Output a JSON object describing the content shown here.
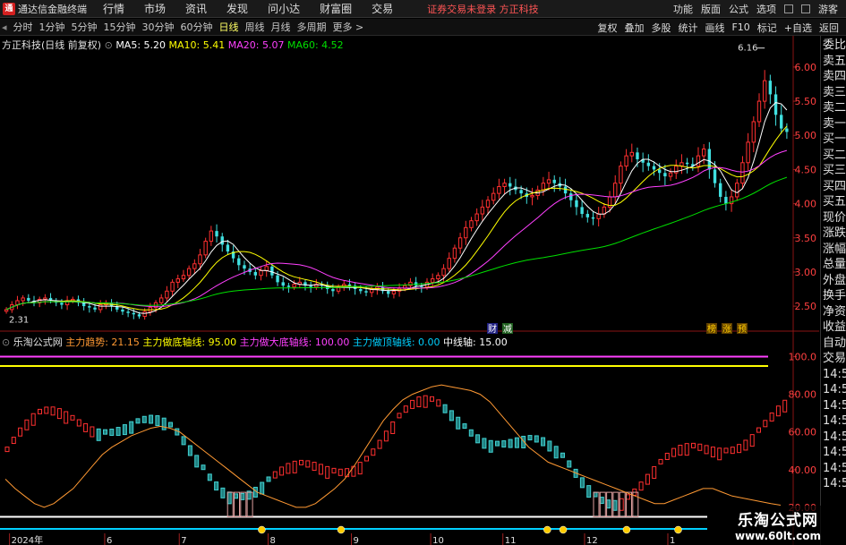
{
  "app": {
    "title": "通达信金融终端",
    "menu": [
      "行情",
      "市场",
      "资讯",
      "发现",
      "问小达",
      "财富圈",
      "交易"
    ],
    "notice": "证券交易未登录  方正科技",
    "right_menu": [
      "功能",
      "版面",
      "公式",
      "选项"
    ],
    "guest": "游客"
  },
  "periods": [
    "分时",
    "1分钟",
    "5分钟",
    "15分钟",
    "30分钟",
    "60分钟",
    "日线",
    "周线",
    "月线",
    "多周期",
    "更多 >"
  ],
  "active_period": "日线",
  "tools": [
    "复权",
    "叠加",
    "多股",
    "统计",
    "画线",
    "F10",
    "标记",
    "+自选",
    "返回"
  ],
  "stock_line": {
    "name": "方正科技(日线 前复权)",
    "ma": [
      {
        "label": "MA5: 5.20",
        "color": "#ffffff"
      },
      {
        "label": "MA10: 5.41",
        "color": "#ffff00"
      },
      {
        "label": "MA20: 5.07",
        "color": "#ff40ff"
      },
      {
        "label": "MA60: 4.52",
        "color": "#00e000"
      }
    ]
  },
  "price_axis": [
    "6.00",
    "5.50",
    "5.00",
    "4.50",
    "4.00",
    "3.50",
    "3.00",
    "2.50"
  ],
  "markers": {
    "high": "6.16",
    "low": "2.31",
    "fin": "财",
    "jian": "减",
    "tags": [
      "榜",
      "涨",
      "预"
    ]
  },
  "indicator_line": {
    "name": "乐淘公式网",
    "items": [
      {
        "label": "主力趋势: 21.15",
        "color": "#ff9933"
      },
      {
        "label": "主力做底轴线: 95.00",
        "color": "#ffff00"
      },
      {
        "label": "主力做大底轴线: 100.00",
        "color": "#ff40ff"
      },
      {
        "label": "主力做顶轴线: 0.00",
        "color": "#00d0ff"
      },
      {
        "label": "中线轴: 15.00",
        "color": "#ffffff"
      }
    ]
  },
  "indicator_axis": [
    "100.0",
    "80.00",
    "60.00",
    "40.00",
    "20.00"
  ],
  "time_axis": [
    {
      "label": "2024年",
      "x": 0.012
    },
    {
      "label": "6",
      "x": 0.132
    },
    {
      "label": "7",
      "x": 0.226
    },
    {
      "label": "8",
      "x": 0.338
    },
    {
      "label": "9",
      "x": 0.443
    },
    {
      "label": "10",
      "x": 0.543
    },
    {
      "label": "11",
      "x": 0.634
    },
    {
      "label": "12",
      "x": 0.737
    },
    {
      "label": "1",
      "x": 0.842
    }
  ],
  "right_panel": [
    "委比",
    "卖五",
    "卖四",
    "卖三",
    "卖二",
    "卖一",
    "买一",
    "买二",
    "买三",
    "买四",
    "买五",
    "现价",
    "涨跌",
    "涨幅",
    "总量",
    "外盘",
    "换手",
    "净资",
    "收益",
    "自动",
    "交易",
    "14:56",
    "14:56",
    "14:56",
    "14:56",
    "14:56",
    "14:56",
    "14:56",
    "14:56"
  ],
  "watermark": {
    "line1": "乐淘公式网",
    "line2": "www.60lt.com"
  },
  "chart_data": {
    "type": "candlestick",
    "series": "daily",
    "first_close": 2.45,
    "last_close": 5.05,
    "high": 6.16,
    "low": 2.31,
    "ma": {
      "MA5": 5.2,
      "MA10": 5.41,
      "MA20": 5.07,
      "MA60": 4.52
    },
    "price_range": [
      2.2,
      6.3
    ],
    "indicator_range": [
      10,
      105
    ],
    "closes": [
      2.45,
      2.52,
      2.58,
      2.62,
      2.58,
      2.55,
      2.6,
      2.62,
      2.58,
      2.55,
      2.52,
      2.58,
      2.6,
      2.55,
      2.5,
      2.48,
      2.45,
      2.52,
      2.55,
      2.5,
      2.45,
      2.42,
      2.4,
      2.38,
      2.35,
      2.42,
      2.48,
      2.55,
      2.62,
      2.72,
      2.85,
      2.9,
      2.95,
      3.05,
      3.12,
      3.25,
      3.45,
      3.6,
      3.52,
      3.4,
      3.3,
      3.2,
      3.1,
      3.05,
      3.0,
      2.95,
      3.02,
      3.08,
      2.95,
      2.85,
      2.8,
      2.78,
      2.82,
      2.85,
      2.8,
      2.78,
      2.82,
      2.8,
      2.75,
      2.72,
      2.78,
      2.82,
      2.8,
      2.75,
      2.72,
      2.7,
      2.75,
      2.78,
      2.72,
      2.68,
      2.72,
      2.76,
      2.8,
      2.85,
      2.8,
      2.78,
      2.85,
      2.9,
      2.95,
      3.05,
      3.2,
      3.35,
      3.5,
      3.65,
      3.75,
      3.85,
      3.95,
      4.05,
      4.15,
      4.25,
      4.3,
      4.25,
      4.2,
      4.15,
      4.1,
      4.12,
      4.2,
      4.3,
      4.35,
      4.3,
      4.25,
      4.15,
      4.05,
      3.95,
      3.85,
      3.8,
      3.78,
      3.85,
      3.95,
      4.1,
      4.3,
      4.55,
      4.7,
      4.75,
      4.65,
      4.6,
      4.55,
      4.5,
      4.45,
      4.4,
      4.45,
      4.55,
      4.6,
      4.58,
      4.55,
      4.7,
      4.8,
      4.5,
      4.3,
      4.1,
      4.0,
      4.1,
      4.3,
      4.6,
      4.9,
      5.2,
      5.5,
      5.8,
      5.6,
      5.3,
      5.1,
      5.05
    ],
    "trend": [
      35,
      30,
      26,
      22,
      20,
      22,
      26,
      30,
      36,
      42,
      48,
      52,
      55,
      58,
      60,
      62,
      63,
      62,
      60,
      56,
      52,
      48,
      44,
      40,
      36,
      32,
      28,
      26,
      24,
      22,
      20,
      20,
      22,
      26,
      30,
      35,
      42,
      50,
      58,
      66,
      72,
      77,
      80,
      82,
      84,
      85,
      84,
      83,
      82,
      80,
      76,
      70,
      64,
      58,
      52,
      48,
      44,
      42,
      40,
      38,
      36,
      34,
      32,
      30,
      28,
      26,
      24,
      22,
      22,
      24,
      26,
      28,
      30,
      30,
      28,
      26,
      25,
      24,
      23,
      22,
      21.15
    ],
    "bottom_signals": [
      0.33,
      0.43,
      0.69,
      0.71,
      0.79,
      0.855
    ]
  }
}
